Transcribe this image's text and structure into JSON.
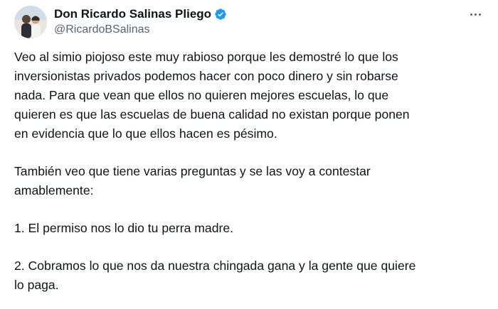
{
  "author": {
    "display_name": "Don Ricardo Salinas Pliego",
    "handle": "@RicardoBSalinas",
    "verified": true,
    "verified_color": "#1d9bf0"
  },
  "menu": {
    "more_icon": "more-horizontal-icon"
  },
  "tweet": {
    "paragraphs": [
      {
        "lines": [
          "Veo al simio piojoso este muy rabioso porque les demostré lo que los",
          "inversionistas privados podemos hacer con poco dinero y sin robarse",
          "nada. Para que vean que ellos no quieren mejores escuelas, lo que",
          "quieren es que las escuelas de buena calidad no existan porque ponen",
          "en evidencia que lo que ellos hacen es pésimo."
        ]
      },
      {
        "lines": [
          "También veo que tiene varias preguntas y se las voy a contestar",
          "amablemente:"
        ]
      },
      {
        "lines": [
          "1. El permiso nos lo dio tu perra madre."
        ]
      },
      {
        "lines": [
          "2. Cobramos lo que nos da nuestra chingada gana y la gente que quiere",
          "lo paga."
        ]
      }
    ]
  }
}
